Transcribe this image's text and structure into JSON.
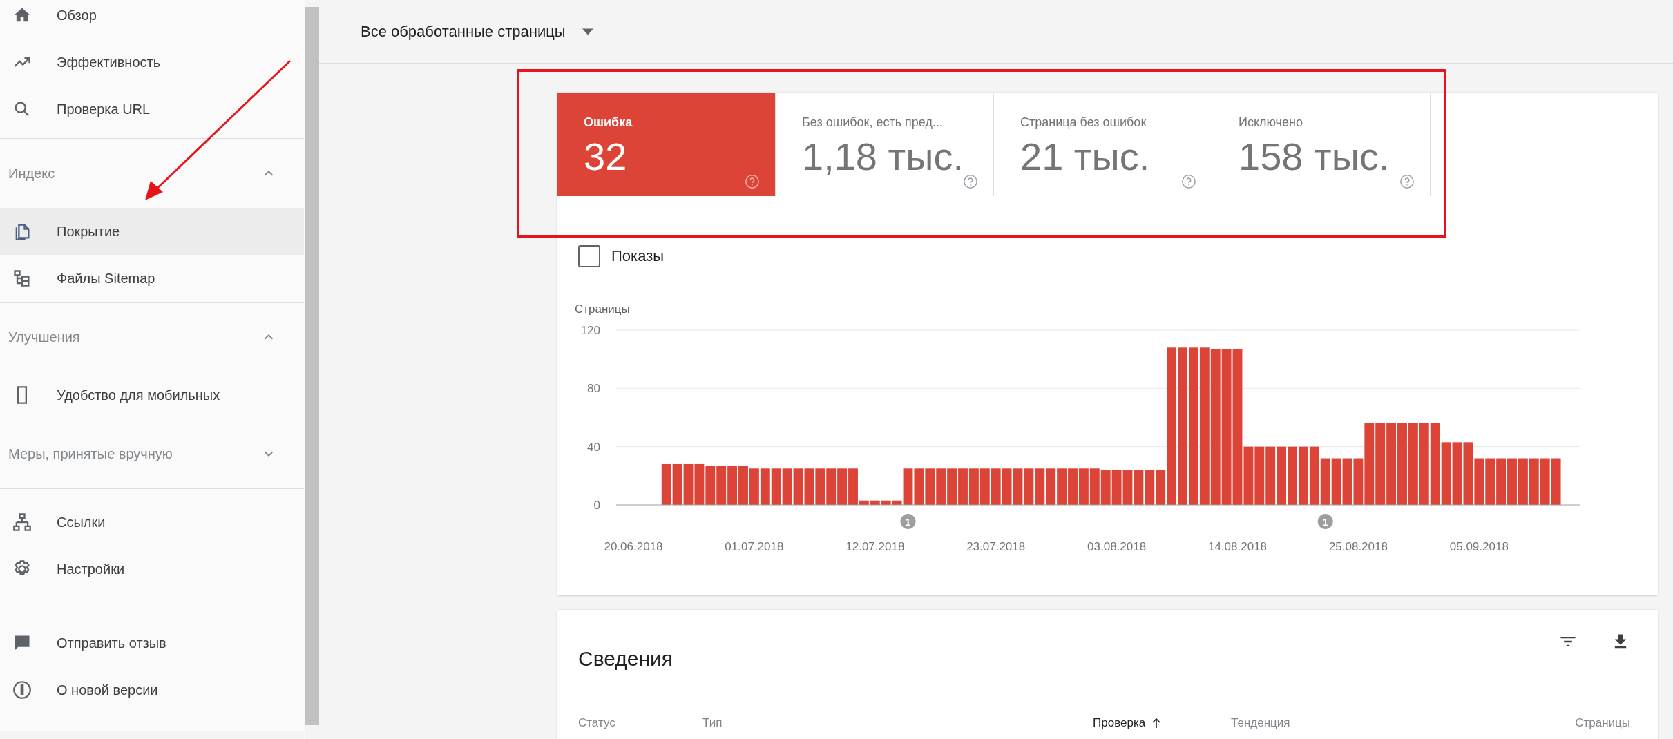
{
  "sidebar": {
    "groups": [
      {
        "items": [
          {
            "label": "Обзор",
            "selected": false
          },
          {
            "label": "Эффективность",
            "selected": false
          },
          {
            "label": "Проверка URL",
            "selected": false
          }
        ]
      },
      {
        "title": "Индекс",
        "expanded": true,
        "items": [
          {
            "label": "Покрытие",
            "selected": true
          },
          {
            "label": "Файлы Sitemap",
            "selected": false
          }
        ]
      },
      {
        "title": "Улучшения",
        "expanded": true,
        "items": [
          {
            "label": "Удобство для мобильных",
            "selected": false
          }
        ]
      },
      {
        "title": "Меры, принятые вручную",
        "expanded": false
      },
      {
        "items": [
          {
            "label": "Ссылки",
            "selected": false
          },
          {
            "label": "Настройки",
            "selected": false
          }
        ]
      },
      {
        "items": [
          {
            "label": "Отправить отзыв",
            "selected": false
          },
          {
            "label": "О новой версии",
            "selected": false
          }
        ]
      }
    ]
  },
  "header": {
    "dropdown": "Все обработанные страницы"
  },
  "tiles": [
    {
      "label": "Ошибка",
      "value": "32",
      "selected": true
    },
    {
      "label": "Без ошибок, есть пред...",
      "value": "1,18 тыс.",
      "selected": false
    },
    {
      "label": "Страница без ошибок",
      "value": "21 тыс.",
      "selected": false
    },
    {
      "label": "Исключено",
      "value": "158 тыс.",
      "selected": false
    }
  ],
  "impressions": {
    "label": "Показы",
    "checked": false
  },
  "chart_data": {
    "type": "bar",
    "ylabel": "Страницы",
    "categories": [
      "20.06.2018",
      null,
      null,
      null,
      null,
      null,
      null,
      null,
      null,
      null,
      null,
      "01.07.2018",
      null,
      null,
      null,
      null,
      null,
      null,
      null,
      null,
      null,
      null,
      "12.07.2018",
      null,
      null,
      null,
      null,
      null,
      null,
      null,
      null,
      null,
      null,
      "23.07.2018",
      null,
      null,
      null,
      null,
      null,
      null,
      null,
      null,
      null,
      null,
      "03.08.2018",
      null,
      null,
      null,
      null,
      null,
      null,
      null,
      null,
      null,
      null,
      "14.08.2018",
      null,
      null,
      null,
      null,
      null,
      null,
      null,
      null,
      null,
      null,
      "25.08.2018",
      null,
      null,
      null,
      null,
      null,
      null,
      null,
      null,
      null,
      null,
      "05.09.2018",
      null,
      null,
      null,
      null,
      null,
      null,
      null
    ],
    "series": [
      {
        "color": "#db4437",
        "values": [
          null,
          null,
          null,
          28,
          28,
          28,
          28,
          27,
          27,
          27,
          27,
          25,
          25,
          25,
          25,
          25,
          25,
          25,
          25,
          25,
          25,
          3,
          3,
          3,
          3,
          25,
          25,
          25,
          25,
          25,
          25,
          25,
          25,
          25,
          25,
          25,
          25,
          25,
          25,
          25,
          25,
          25,
          25,
          24,
          24,
          24,
          24,
          24,
          24,
          108,
          108,
          108,
          108,
          107,
          107,
          107,
          40,
          40,
          40,
          40,
          40,
          40,
          40,
          32,
          32,
          32,
          32,
          56,
          56,
          56,
          56,
          56,
          56,
          56,
          43,
          43,
          43,
          32,
          32,
          32,
          32,
          32,
          32,
          32,
          32
        ]
      }
    ],
    "ylim": [
      0,
      120
    ],
    "yticks": [
      0,
      40,
      80,
      120
    ],
    "annotations": [
      "1",
      "1"
    ]
  },
  "details": {
    "title": "Сведения",
    "columns": [
      {
        "label": "Статус",
        "sorted": false
      },
      {
        "label": "Тип",
        "sorted": false
      },
      {
        "label": "Проверка",
        "sorted": true
      },
      {
        "label": "Тенденция",
        "sorted": false
      },
      {
        "label": "Страницы",
        "sorted": false
      }
    ]
  }
}
